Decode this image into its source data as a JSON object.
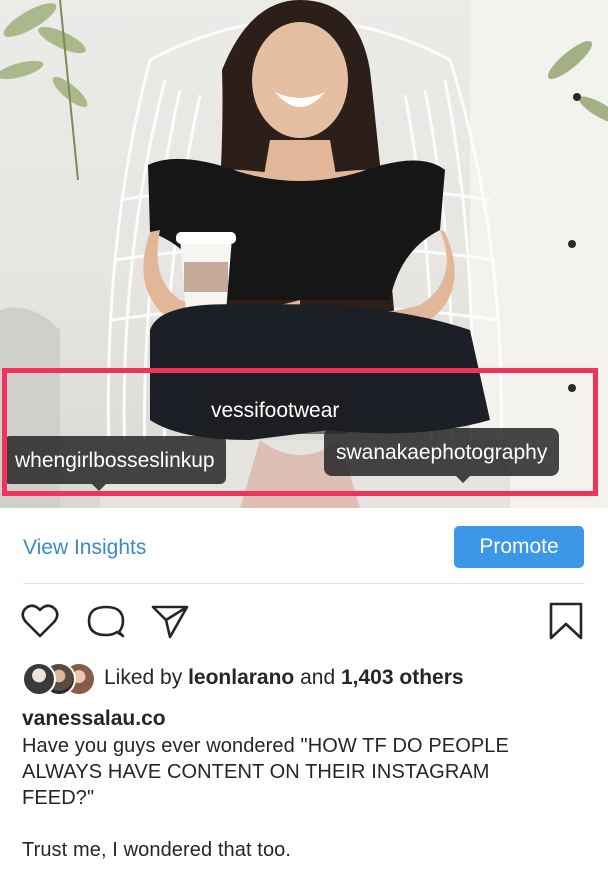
{
  "photo": {
    "alt_subject": "post-photo",
    "tags": {
      "vessi": "vessifootwear",
      "when": "whengirlbosseslinkup",
      "swan": "swanakaephotography"
    },
    "highlight_color": "#f0335a"
  },
  "insights": {
    "view_label": "View Insights",
    "promote_label": "Promote",
    "link_color": "#3a8ad0",
    "button_color": "#3c97e8"
  },
  "actions": {
    "like_icon": "heart-icon",
    "comment_icon": "comment-bubble-icon",
    "share_icon": "paper-plane-icon",
    "save_icon": "bookmark-icon"
  },
  "likes": {
    "prefix": "Liked by ",
    "user": "leonlarano",
    "middle": " and ",
    "count": "1,403 others"
  },
  "caption": {
    "username": "vanessalau.co",
    "lines": [
      "Have you guys ever wondered \"HOW TF DO PEOPLE",
      "ALWAYS HAVE CONTENT ON THEIR INSTAGRAM",
      "FEED?\"",
      "",
      "Trust me, I wondered that too."
    ]
  }
}
